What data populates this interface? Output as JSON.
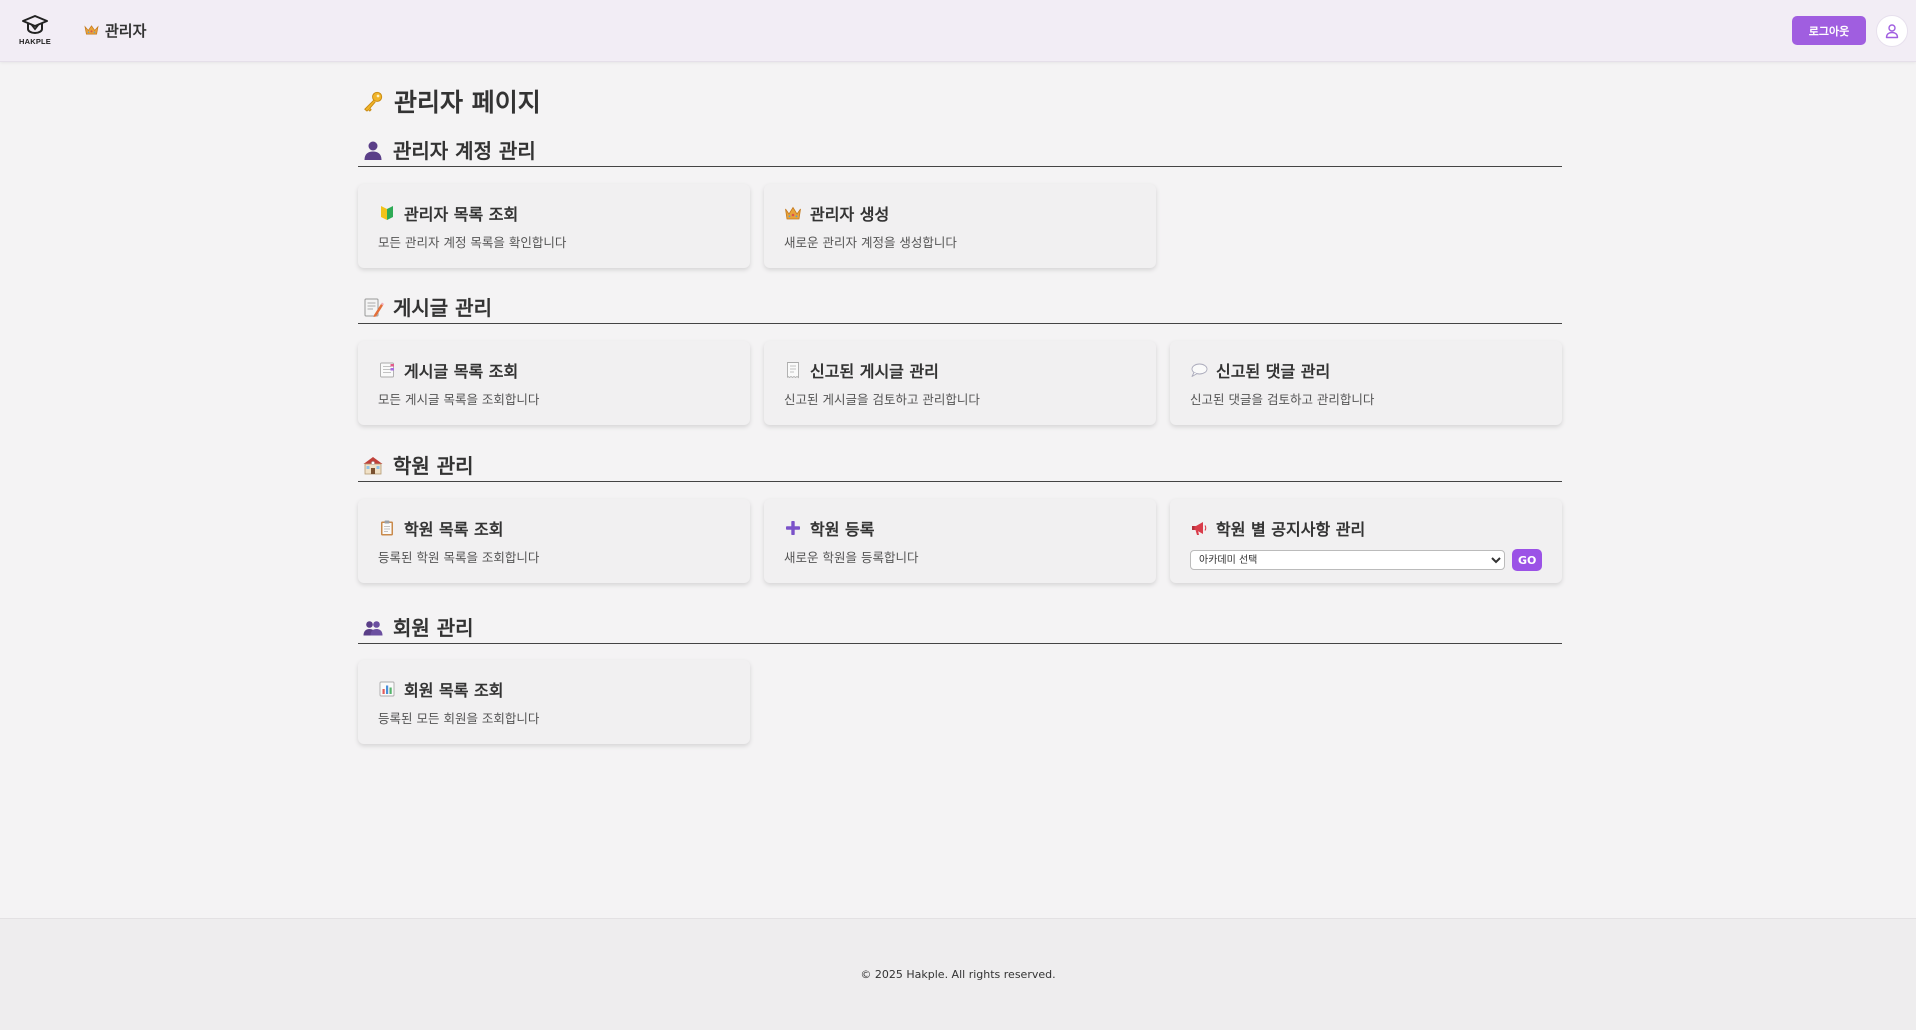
{
  "header": {
    "logo_text": "HAKPLE",
    "admin_label": "관리자",
    "logout_label": "로그아웃",
    "icons": {
      "crown": "crown-icon",
      "user": "user-icon",
      "logo": "hakple-logo-icon"
    }
  },
  "page": {
    "title": "관리자 페이지",
    "title_icon": "key-icon"
  },
  "sections": [
    {
      "heading": "관리자 계정 관리",
      "icon": "person-icon",
      "cards": [
        {
          "title": "관리자 목록 조회",
          "desc": "모든 관리자 계정 목록을 확인합니다",
          "icon": "beginner-badge-icon"
        },
        {
          "title": "관리자 생성",
          "desc": "새로운 관리자 계정을 생성합니다",
          "icon": "crown-icon"
        }
      ]
    },
    {
      "heading": "게시글 관리",
      "icon": "memo-icon",
      "cards": [
        {
          "title": "게시글 목록 조회",
          "desc": "모든 게시글 목록을 조회합니다",
          "icon": "bookmark-tabs-icon"
        },
        {
          "title": "신고된 게시글 관리",
          "desc": "신고된 게시글을 검토하고 관리합니다",
          "icon": "receipt-icon"
        },
        {
          "title": "신고된 댓글 관리",
          "desc": "신고된 댓글을 검토하고 관리합니다",
          "icon": "speech-bubble-icon"
        }
      ]
    },
    {
      "heading": "학원 관리",
      "icon": "school-icon",
      "cards": [
        {
          "title": "학원 목록 조회",
          "desc": "등록된 학원 목록을 조회합니다",
          "icon": "clipboard-icon"
        },
        {
          "title": "학원 등록",
          "desc": "새로운 학원을 등록합니다",
          "icon": "plus-icon"
        },
        {
          "title": "학원 별 공지사항 관리",
          "icon": "megaphone-icon",
          "select_value": "아카데미 선택",
          "go_label": "GO"
        }
      ]
    },
    {
      "heading": "회원 관리",
      "icon": "people-icon",
      "cards": [
        {
          "title": "회원 목록 조회",
          "desc": "등록된 모든 회원을 조회합니다",
          "icon": "bar-chart-icon"
        }
      ]
    }
  ],
  "footer": {
    "copyright": "© 2025 Hakple. All rights reserved."
  },
  "colors": {
    "accent": "#a05ee0",
    "go_button": "#9b52e6",
    "header_bg": "#f2edf5",
    "page_bg": "#f4f3f4"
  }
}
